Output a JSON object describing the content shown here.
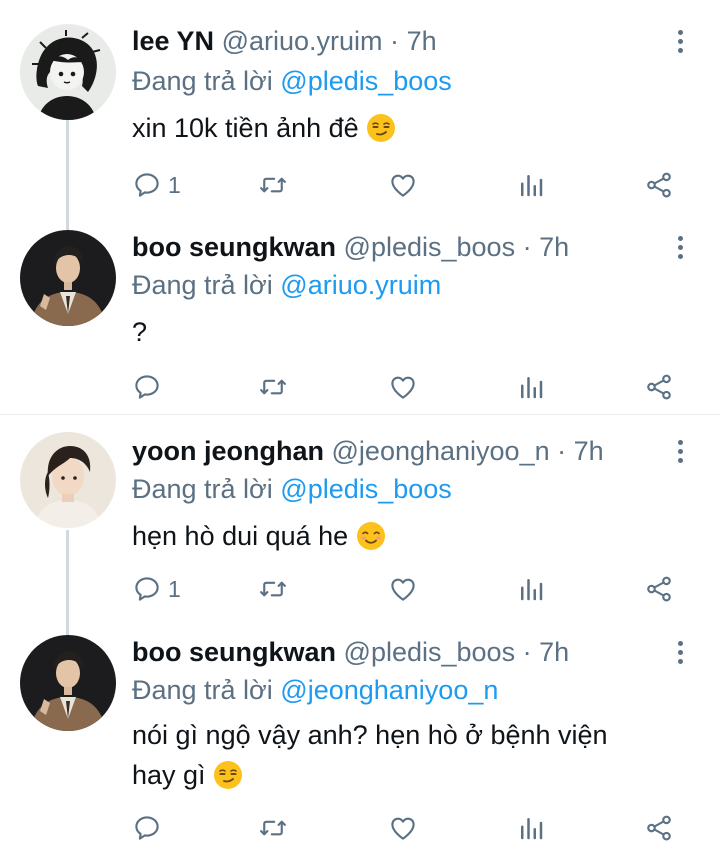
{
  "tweets": [
    {
      "name": "lee YN",
      "handle": "@ariuo.yruim",
      "time": "7h",
      "reply_prefix": "Đang trả lời",
      "reply_mention": "@pledis_boos",
      "text": "xin 10k tiền ảnh đê",
      "emoji": "smirking-face",
      "reply_count": "1",
      "avatar": "cartoon-girl-avatar"
    },
    {
      "name": "boo seungkwan",
      "handle": "@pledis_boos",
      "time": "7h",
      "reply_prefix": "Đang trả lời",
      "reply_mention": "@ariuo.yruim",
      "text": "?",
      "emoji": "",
      "reply_count": "",
      "avatar": "man-in-suit-avatar"
    },
    {
      "name": "yoon jeonghan",
      "handle": "@jeonghaniyoo_n",
      "time": "7h",
      "reply_prefix": "Đang trả lời",
      "reply_mention": "@pledis_boos",
      "text": "hẹn hò dui quá he",
      "emoji": "smiling-face",
      "reply_count": "1",
      "avatar": "young-man-avatar"
    },
    {
      "name": "boo seungkwan",
      "handle": "@pledis_boos",
      "time": "7h",
      "reply_prefix": "Đang trả lời",
      "reply_mention": "@jeonghaniyoo_n",
      "text_line1": "nói gì ngộ vậy anh? hẹn hò ở bệnh viện",
      "text_line2": "hay gì",
      "emoji": "smirking-face",
      "reply_count": "",
      "avatar": "man-in-suit-avatar"
    }
  ],
  "separator": "·",
  "colors": {
    "text": "#0f1419",
    "secondary": "#5b7083",
    "mention": "#1d9bf0",
    "thread_line": "#cfd9de",
    "divider": "#e6ecf0"
  },
  "action_icons": [
    "reply-icon",
    "retweet-icon",
    "like-icon",
    "stats-icon",
    "share-icon"
  ]
}
